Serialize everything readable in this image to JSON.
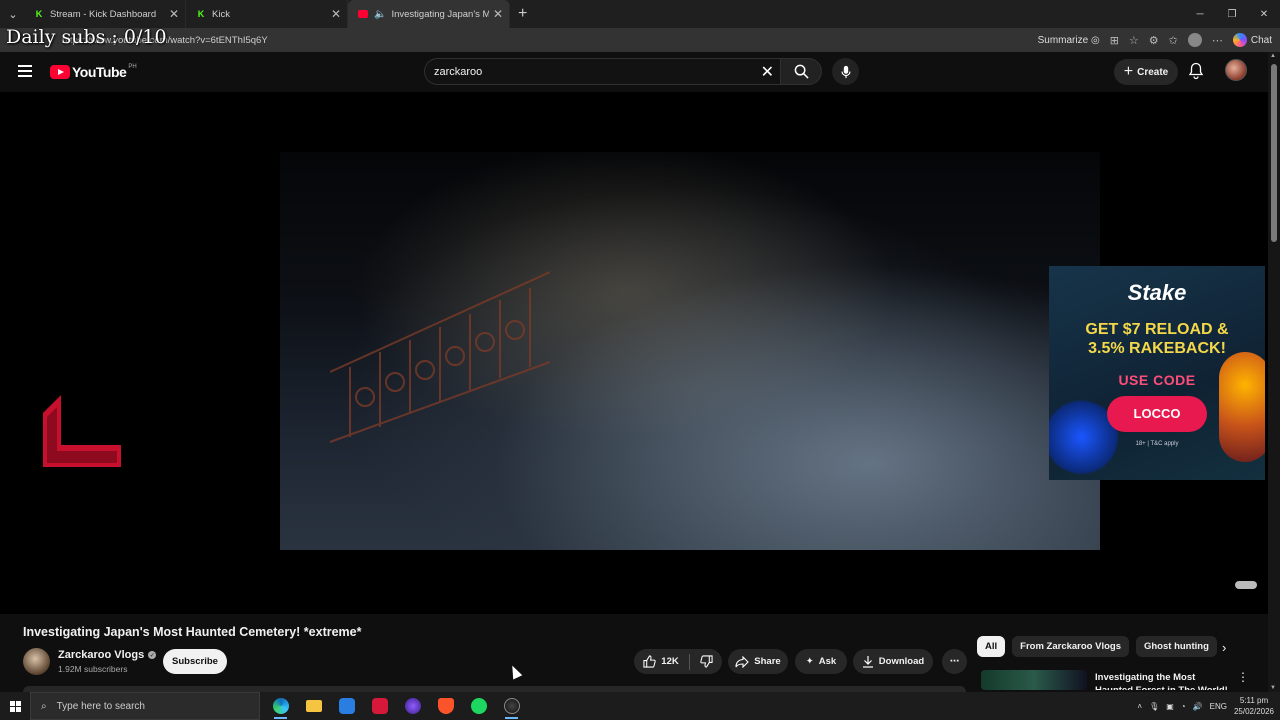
{
  "overlay": {
    "daily_subs": "Daily subs : 0/10"
  },
  "browser": {
    "tabs": [
      {
        "title": "Stream - Kick Dashboard",
        "favicon": "kick-icon"
      },
      {
        "title": "Kick",
        "favicon": "kick-icon"
      },
      {
        "title": "Investigating Japan's Most Ha",
        "favicon": "youtube-icon",
        "audio": true,
        "active": true
      }
    ],
    "url": "https://www.youtube.com/watch?v=6tENThI5q6Y",
    "summarize_label": "Summarize",
    "chat_label": "Chat"
  },
  "youtube": {
    "logo_text": "YouTube",
    "country_code": "PH",
    "search_query": "zarckaroo",
    "create_label": "Create"
  },
  "ad": {
    "brand": "Stake",
    "headline_line1": "GET $7 RELOAD &",
    "headline_line2": "3.5% RAKEBACK!",
    "use_code": "USE CODE",
    "code": "LOCCO",
    "terms": "18+ | T&C apply"
  },
  "video": {
    "title": "Investigating Japan's Most Haunted Cemetery! *extreme*",
    "channel": "Zarckaroo Vlogs",
    "subscribers": "1.92M subscribers",
    "subscribe_label": "Subscribe",
    "likes": "12K",
    "share_label": "Share",
    "ask_label": "Ask",
    "download_label": "Download"
  },
  "chips": [
    "All",
    "From Zarckaroo Vlogs",
    "Ghost hunting"
  ],
  "related": {
    "title": "Investigating the Most Haunted Forest in The World! (Suicide"
  },
  "taskbar": {
    "search_placeholder": "Type here to search",
    "language": "ENG",
    "time": "5:11 pm",
    "date": "25/02/2026"
  },
  "colors": {
    "youtube_red": "#ff0033",
    "kick_green": "#53fc18",
    "stake_pink": "#e8194e",
    "stake_yellow": "#f5d84a"
  }
}
